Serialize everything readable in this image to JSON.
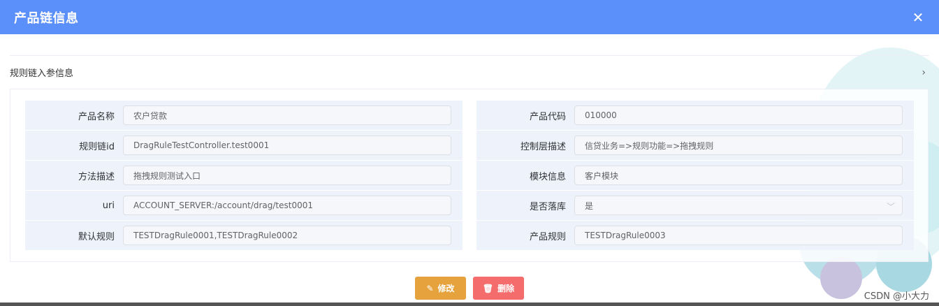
{
  "dialog": {
    "title": "产品链信息"
  },
  "section": {
    "title": "规则链入参信息"
  },
  "fields": [
    [
      {
        "label": "产品名称",
        "value": "农户贷款"
      },
      {
        "label": "产品代码",
        "value": "010000"
      }
    ],
    [
      {
        "label": "规则链id",
        "value": "DragRuleTestController.test0001"
      },
      {
        "label": "控制层描述",
        "value": "信贷业务=>规则功能=>拖拽规则"
      }
    ],
    [
      {
        "label": "方法描述",
        "value": "拖拽规则测试入口"
      },
      {
        "label": "模块信息",
        "value": "客户模块"
      }
    ],
    [
      {
        "label": "uri",
        "value": "ACCOUNT_SERVER:/account/drag/test0001"
      },
      {
        "label": "是否落库",
        "value": "是"
      }
    ],
    [
      {
        "label": "默认规则",
        "value": "TESTDragRule0001,TESTDragRule0002"
      },
      {
        "label": "产品规则",
        "value": "TESTDragRule0003"
      }
    ]
  ],
  "buttons": {
    "edit": "修改",
    "delete": "删除"
  },
  "watermark": "CSDN @小大力",
  "colors": {
    "titlebar": "#5b8ff9",
    "edit": "#e6a23c",
    "delete": "#f56c6c"
  }
}
